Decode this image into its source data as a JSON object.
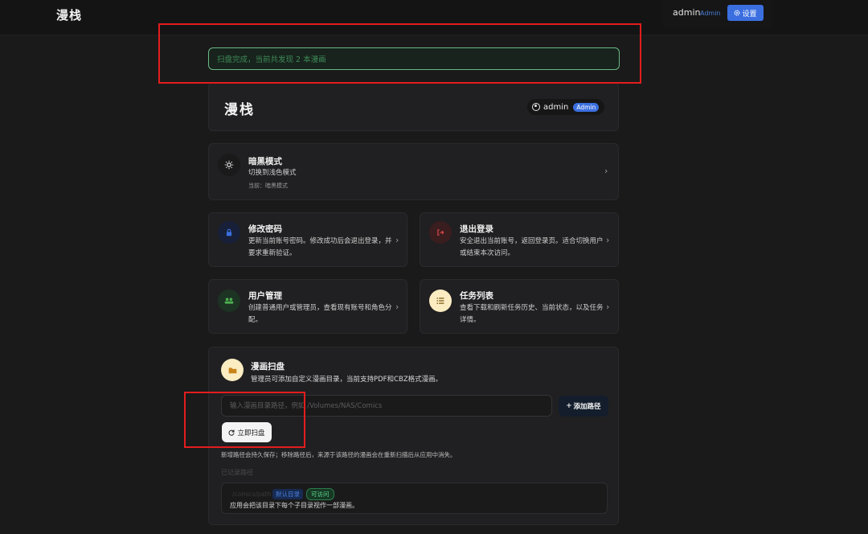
{
  "header": {
    "logo": "漫栈",
    "username": "admin",
    "role": "Admin",
    "settings_label": "设置"
  },
  "toast": {
    "message": "扫盘完成，当前共发现 2 本漫画"
  },
  "profile": {
    "title": "漫栈",
    "username": "admin",
    "role_badge": "Admin"
  },
  "dark_mode": {
    "title": "暗黑模式",
    "desc": "切换到浅色模式",
    "current": "当前：暗黑模式"
  },
  "change_password": {
    "title": "修改密码",
    "desc": "更新当前账号密码。修改成功后会退出登录，并要求重新验证。"
  },
  "logout": {
    "title": "退出登录",
    "desc": "安全退出当前账号，返回登录页。适合切换用户或结束本次访问。"
  },
  "user_mgmt": {
    "title": "用户管理",
    "desc": "创建普通用户或管理员，查看现有账号和角色分配。"
  },
  "task_list": {
    "title": "任务列表",
    "desc": "查看下载和刷新任务历史、当前状态，以及任务详情。"
  },
  "scan": {
    "title": "漫画扫盘",
    "desc": "管理员可添加自定义漫画目录，当前支持PDF和CBZ格式漫画。",
    "input_placeholder": "输入漫画目录路径，例如 /Volumes/NAS/Comics",
    "add_label": "添加路径",
    "scan_label": "立即扫盘",
    "hint": "新增路径会持久保存；移除路径后，来源于该路径的漫画会在重新扫描后从应用中消失。",
    "saved_label": "已记录路径",
    "paths": [
      {
        "path": "/comics/path",
        "tag_default": "默认目录",
        "tag_status": "可访问",
        "desc": "应用会把该目录下每个子目录视作一部漫画。"
      }
    ]
  },
  "colors": {
    "accent": "#3b6fe0",
    "success": "#5fd18b",
    "highlight": "#e31d1d"
  }
}
